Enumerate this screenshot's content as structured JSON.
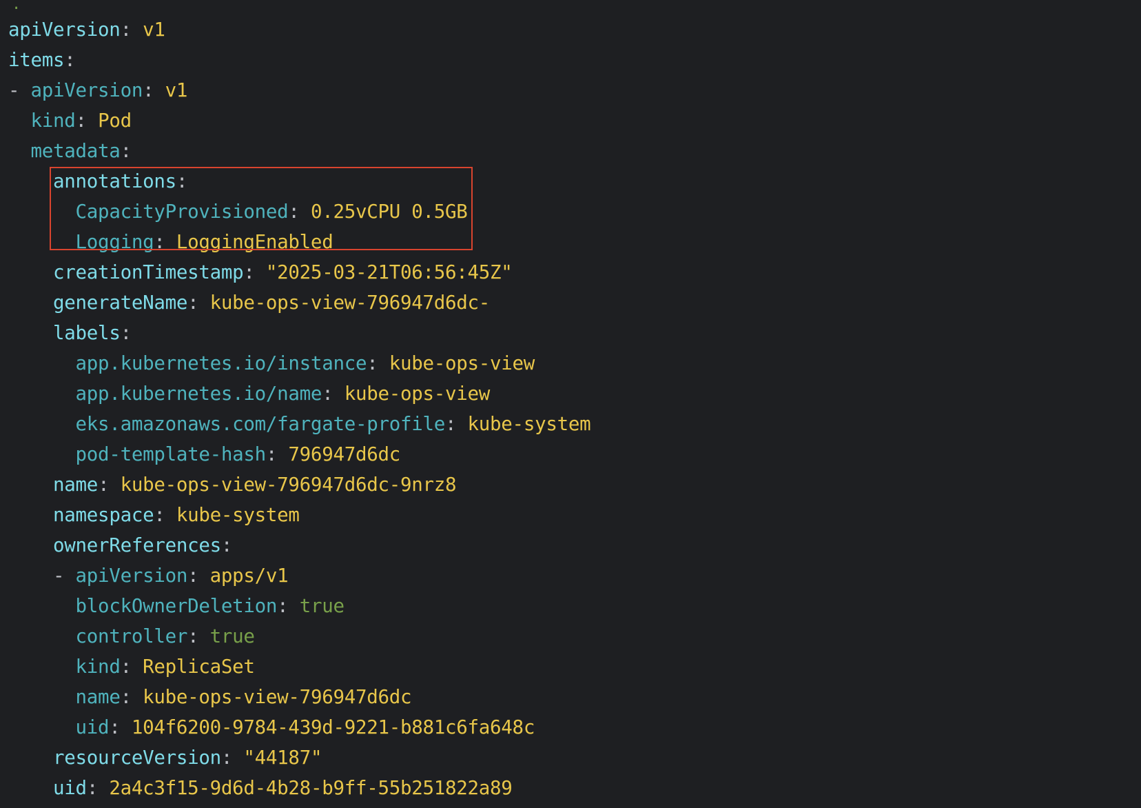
{
  "top_marker": ".",
  "lines": [
    {
      "indent": "",
      "dash": "",
      "key": "apiVersion",
      "key_style": "k1",
      "sep": ": ",
      "value": "v1",
      "val_style": "str"
    },
    {
      "indent": "",
      "dash": "",
      "key": "items",
      "key_style": "k1",
      "sep": ":",
      "value": "",
      "val_style": "str"
    },
    {
      "indent": "",
      "dash": "- ",
      "key": "apiVersion",
      "key_style": "k2",
      "sep": ": ",
      "value": "v1",
      "val_style": "str"
    },
    {
      "indent": "  ",
      "dash": "",
      "key": "kind",
      "key_style": "k2",
      "sep": ": ",
      "value": "Pod",
      "val_style": "str"
    },
    {
      "indent": "  ",
      "dash": "",
      "key": "metadata",
      "key_style": "k2",
      "sep": ":",
      "value": "",
      "val_style": "str"
    },
    {
      "indent": "    ",
      "dash": "",
      "key": "annotations",
      "key_style": "k1",
      "sep": ":",
      "value": "",
      "val_style": "str"
    },
    {
      "indent": "      ",
      "dash": "",
      "key": "CapacityProvisioned",
      "key_style": "k2",
      "sep": ": ",
      "value": "0.25vCPU 0.5GB",
      "val_style": "str"
    },
    {
      "indent": "      ",
      "dash": "",
      "key": "Logging",
      "key_style": "k2",
      "sep": ": ",
      "value": "LoggingEnabled",
      "val_style": "str"
    },
    {
      "indent": "    ",
      "dash": "",
      "key": "creationTimestamp",
      "key_style": "k1",
      "sep": ": ",
      "value": "\"2025-03-21T06:56:45Z\"",
      "val_style": "str"
    },
    {
      "indent": "    ",
      "dash": "",
      "key": "generateName",
      "key_style": "k1",
      "sep": ": ",
      "value": "kube-ops-view-796947d6dc-",
      "val_style": "str"
    },
    {
      "indent": "    ",
      "dash": "",
      "key": "labels",
      "key_style": "k1",
      "sep": ":",
      "value": "",
      "val_style": "str"
    },
    {
      "indent": "      ",
      "dash": "",
      "key": "app.kubernetes.io/instance",
      "key_style": "k2",
      "sep": ": ",
      "value": "kube-ops-view",
      "val_style": "str"
    },
    {
      "indent": "      ",
      "dash": "",
      "key": "app.kubernetes.io/name",
      "key_style": "k2",
      "sep": ": ",
      "value": "kube-ops-view",
      "val_style": "str"
    },
    {
      "indent": "      ",
      "dash": "",
      "key": "eks.amazonaws.com/fargate-profile",
      "key_style": "k2",
      "sep": ": ",
      "value": "kube-system",
      "val_style": "str"
    },
    {
      "indent": "      ",
      "dash": "",
      "key": "pod-template-hash",
      "key_style": "k2",
      "sep": ": ",
      "value": "796947d6dc",
      "val_style": "str"
    },
    {
      "indent": "    ",
      "dash": "",
      "key": "name",
      "key_style": "k1",
      "sep": ": ",
      "value": "kube-ops-view-796947d6dc-9nrz8",
      "val_style": "str"
    },
    {
      "indent": "    ",
      "dash": "",
      "key": "namespace",
      "key_style": "k1",
      "sep": ": ",
      "value": "kube-system",
      "val_style": "str"
    },
    {
      "indent": "    ",
      "dash": "",
      "key": "ownerReferences",
      "key_style": "k1",
      "sep": ":",
      "value": "",
      "val_style": "str"
    },
    {
      "indent": "    ",
      "dash": "- ",
      "key": "apiVersion",
      "key_style": "k2",
      "sep": ": ",
      "value": "apps/v1",
      "val_style": "str"
    },
    {
      "indent": "      ",
      "dash": "",
      "key": "blockOwnerDeletion",
      "key_style": "k2",
      "sep": ": ",
      "value": "true",
      "val_style": "bool"
    },
    {
      "indent": "      ",
      "dash": "",
      "key": "controller",
      "key_style": "k2",
      "sep": ": ",
      "value": "true",
      "val_style": "bool"
    },
    {
      "indent": "      ",
      "dash": "",
      "key": "kind",
      "key_style": "k2",
      "sep": ": ",
      "value": "ReplicaSet",
      "val_style": "str"
    },
    {
      "indent": "      ",
      "dash": "",
      "key": "name",
      "key_style": "k2",
      "sep": ": ",
      "value": "kube-ops-view-796947d6dc",
      "val_style": "str"
    },
    {
      "indent": "      ",
      "dash": "",
      "key": "uid",
      "key_style": "k2",
      "sep": ": ",
      "value": "104f6200-9784-439d-9221-b881c6fa648c",
      "val_style": "str"
    },
    {
      "indent": "    ",
      "dash": "",
      "key": "resourceVersion",
      "key_style": "k1",
      "sep": ": ",
      "value": "\"44187\"",
      "val_style": "str"
    },
    {
      "indent": "    ",
      "dash": "",
      "key": "uid",
      "key_style": "k1",
      "sep": ": ",
      "value": "2a4c3f15-9d6d-4b28-b9ff-55b251822a89",
      "val_style": "str"
    }
  ],
  "colors": {
    "background": "#1e1f22",
    "key_primary": "#7fdbe8",
    "key_secondary": "#4fb3bd",
    "string_value": "#e8c64a",
    "boolean_value": "#78a04a",
    "punctuation": "#bcbec4",
    "highlight_border": "#d9442e"
  }
}
